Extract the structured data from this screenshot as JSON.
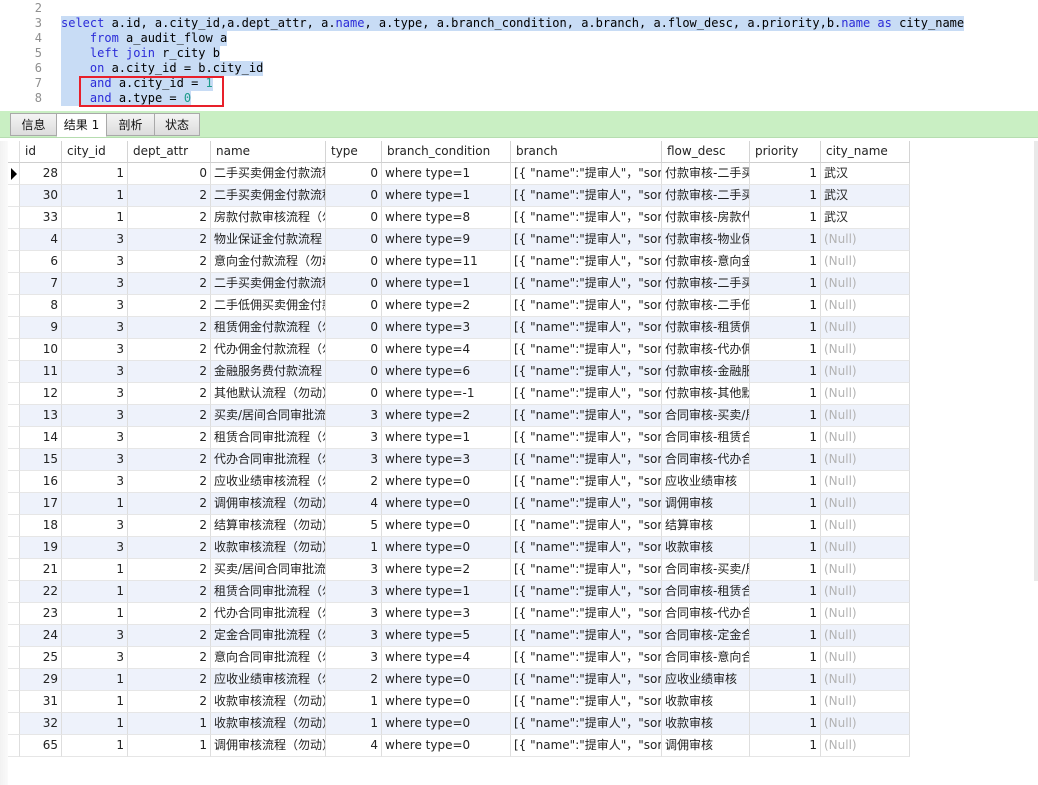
{
  "editor": {
    "lines": [
      {
        "n": "2",
        "parts": []
      },
      {
        "n": "3",
        "parts": [
          [
            "k",
            "select"
          ],
          [
            "t",
            " a.id, a.city_id,a.dept_attr, a."
          ],
          [
            "k",
            "name"
          ],
          [
            "t",
            ", a.type, a.branch_condition, a.branch, a.flow_desc, a.priority,b."
          ],
          [
            "k",
            "name"
          ],
          [
            "t",
            " "
          ],
          [
            "k",
            "as"
          ],
          [
            "t",
            " city_name"
          ]
        ]
      },
      {
        "n": "4",
        "parts": [
          [
            "t",
            "    "
          ],
          [
            "k",
            "from"
          ],
          [
            "t",
            " a_audit_flow a"
          ]
        ]
      },
      {
        "n": "5",
        "parts": [
          [
            "t",
            "    "
          ],
          [
            "k",
            "left join"
          ],
          [
            "t",
            " r_city b"
          ]
        ]
      },
      {
        "n": "6",
        "parts": [
          [
            "t",
            "    "
          ],
          [
            "k",
            "on"
          ],
          [
            "t",
            " a.city_id = b.city_id"
          ]
        ]
      },
      {
        "n": "7",
        "parts": [
          [
            "t",
            "    "
          ],
          [
            "k",
            "and"
          ],
          [
            "t",
            " a.city_id = "
          ],
          [
            "n",
            "1"
          ]
        ]
      },
      {
        "n": "8",
        "parts": [
          [
            "t",
            "    "
          ],
          [
            "k",
            "and"
          ],
          [
            "t",
            " a.type = "
          ],
          [
            "n",
            "0"
          ]
        ]
      }
    ]
  },
  "tabs": [
    {
      "label": "信息",
      "active": false
    },
    {
      "label": "结果 1",
      "active": true
    },
    {
      "label": "剖析",
      "active": false
    },
    {
      "label": "状态",
      "active": false
    }
  ],
  "grid": {
    "columns": [
      "id",
      "city_id",
      "dept_attr",
      "name",
      "type",
      "branch_condition",
      "branch",
      "flow_desc",
      "priority",
      "city_name"
    ],
    "null_text": "(Null)",
    "rows": [
      [
        "28",
        "1",
        "0",
        "二手买卖佣金付款流程",
        "0",
        "where type=1",
        "[{ \"name\":\"提审人\"，\"sort\"",
        "付款审核-二手买卖",
        "1",
        "武汉"
      ],
      [
        "30",
        "1",
        "2",
        "二手买卖佣金付款流程",
        "0",
        "where type=1",
        " [{ \"name\":\"提审人\"，\"sort\"",
        "付款审核-二手买卖",
        "1",
        "武汉"
      ],
      [
        "33",
        "1",
        "2",
        "房款付款审核流程（勿动）",
        "0",
        "where type=8",
        " [{ \"name\":\"提审人\"，\"sort\"",
        "付款审核-房款代付",
        "1",
        "武汉"
      ],
      [
        "4",
        "3",
        "2",
        "物业保证金付款流程",
        "0",
        "where type=9",
        " [{ \"name\":\"提审人\"，\"sort\"",
        "付款审核-物业保证金",
        "1",
        null
      ],
      [
        "6",
        "3",
        "2",
        "意向金付款流程（勿动）",
        "0",
        "where type=11",
        " [{ \"name\":\"提审人\"，\"sort\"",
        "付款审核-意向金",
        "1",
        null
      ],
      [
        "7",
        "3",
        "2",
        "二手买卖佣金付款流程",
        "0",
        "where type=1",
        " [{ \"name\":\"提审人\"，\"sort\"",
        "付款审核-二手买卖",
        "1",
        null
      ],
      [
        "8",
        "3",
        "2",
        "二手低佣买卖佣金付款流程",
        "0",
        "where type=2",
        " [{ \"name\":\"提审人\"，\"sort\"",
        "付款审核-二手低佣",
        "1",
        null
      ],
      [
        "9",
        "3",
        "2",
        "租赁佣金付款流程（勿动）",
        "0",
        "where type=3",
        " [{ \"name\":\"提审人\"，\"sort\"",
        "付款审核-租赁佣金",
        "1",
        null
      ],
      [
        "10",
        "3",
        "2",
        "代办佣金付款流程（勿动）",
        "0",
        "where type=4",
        " [{ \"name\":\"提审人\"，\"sort\"",
        "付款审核-代办佣金",
        "1",
        null
      ],
      [
        "11",
        "3",
        "2",
        "金融服务费付款流程",
        "0",
        "where type=6",
        " [{ \"name\":\"提审人\"，\"sort\"",
        "付款审核-金融服务费",
        "1",
        null
      ],
      [
        "12",
        "3",
        "2",
        "其他默认流程（勿动）",
        "0",
        "where type=-1",
        " [{ \"name\":\"提审人\"，\"sort\"",
        "付款审核-其他默认",
        "1",
        null
      ],
      [
        "13",
        "3",
        "2",
        "买卖/居间合同审批流程",
        "3",
        "where type=2",
        " [{ \"name\":\"提审人\"，\"sort\"",
        "合同审核-买卖/居间",
        "1",
        null
      ],
      [
        "14",
        "3",
        "2",
        "租赁合同审批流程（勿动）",
        "3",
        "where type=1",
        " [{ \"name\":\"提审人\"，\"sort\"",
        "合同审核-租赁合同",
        "1",
        null
      ],
      [
        "15",
        "3",
        "2",
        "代办合同审批流程（勿动）",
        "3",
        "where type=3",
        " [{ \"name\":\"提审人\"，\"sort\"",
        "合同审核-代办合同",
        "1",
        null
      ],
      [
        "16",
        "3",
        "2",
        "应收业绩审核流程（勿动）",
        "2",
        "where type=0",
        " [{ \"name\":\"提审人\"，\"sort\"",
        "应收业绩审核",
        "1",
        null
      ],
      [
        "17",
        "1",
        "2",
        "调佣审核流程（勿动）",
        "4",
        "where type=0",
        "[{ \"name\":\"提审人\"，\"sort\"",
        "调佣审核",
        "1",
        null
      ],
      [
        "18",
        "3",
        "2",
        "结算审核流程（勿动）",
        "5",
        "where type=0",
        " [{ \"name\":\"提审人\"，\"sort\"",
        "结算审核",
        "1",
        null
      ],
      [
        "19",
        "3",
        "2",
        "收款审核流程（勿动）",
        "1",
        "where type=0",
        " [{ \"name\":\"提审人\"，\"sort\"",
        "收款审核",
        "1",
        null
      ],
      [
        "21",
        "1",
        "2",
        "买卖/居间合同审批流程",
        "3",
        "where type=2",
        " [{ \"name\":\"提审人\"，\"sort\"",
        "合同审核-买卖/居间",
        "1",
        null
      ],
      [
        "22",
        "1",
        "2",
        "租赁合同审批流程（勿动）",
        "3",
        "where type=1",
        " [{ \"name\":\"提审人\"，\"sort\"",
        "合同审核-租赁合同",
        "1",
        null
      ],
      [
        "23",
        "1",
        "2",
        "代办合同审批流程（勿动）",
        "3",
        "where type=3",
        " [{ \"name\":\"提审人\"，\"sort\"",
        "合同审核-代办合同",
        "1",
        null
      ],
      [
        "24",
        "3",
        "2",
        "定金合同审批流程（勿动）",
        "3",
        "where type=5",
        " [{ \"name\":\"提审人\"，\"sort\"",
        "合同审核-定金合同",
        "1",
        null
      ],
      [
        "25",
        "3",
        "2",
        "意向合同审批流程（勿动）",
        "3",
        "where type=4",
        " [{ \"name\":\"提审人\"，\"sort\"",
        "合同审核-意向合同",
        "1",
        null
      ],
      [
        "29",
        "1",
        "2",
        "应收业绩审核流程（勿动）",
        "2",
        "where type=0",
        " [{ \"name\":\"提审人\"，\"sort\"",
        "应收业绩审核",
        "1",
        null
      ],
      [
        "31",
        "1",
        "2",
        "收款审核流程（勿动）",
        "1",
        "where type=0",
        " [{ \"name\":\"提审人\"，\"sort\"",
        "收款审核",
        "1",
        null
      ],
      [
        "32",
        "1",
        "1",
        "收款审核流程（勿动）",
        "1",
        "where type=0",
        " [{ \"name\":\"提审人\"，\"sort\"",
        "收款审核",
        "1",
        null
      ],
      [
        "65",
        "1",
        "1",
        "调佣审核流程（勿动）",
        "4",
        "where type=0",
        "[{ \"name\":\"提审人\"，\"sort\"",
        "调佣审核",
        "1",
        null
      ]
    ]
  }
}
